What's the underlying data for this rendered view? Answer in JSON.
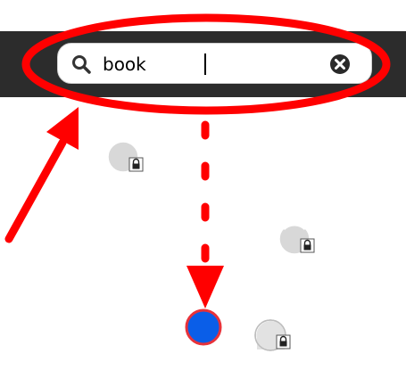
{
  "search": {
    "value": "book",
    "placeholder": "",
    "search_icon": "search-icon",
    "clear_icon": "close-icon"
  },
  "map": {
    "locked_markers": [
      {
        "icon": "lock-icon"
      },
      {
        "icon": "lock-icon"
      },
      {
        "icon": "lock-icon"
      }
    ],
    "current_location": {
      "icon": "location-dot",
      "color": "#0a5ee8"
    }
  },
  "annotation": {
    "color": "#ff0000"
  },
  "colors": {
    "toolbar": "#2c2c2c",
    "marker_fill": "#d8d8d8",
    "accent_blue": "#0a5ee8"
  }
}
